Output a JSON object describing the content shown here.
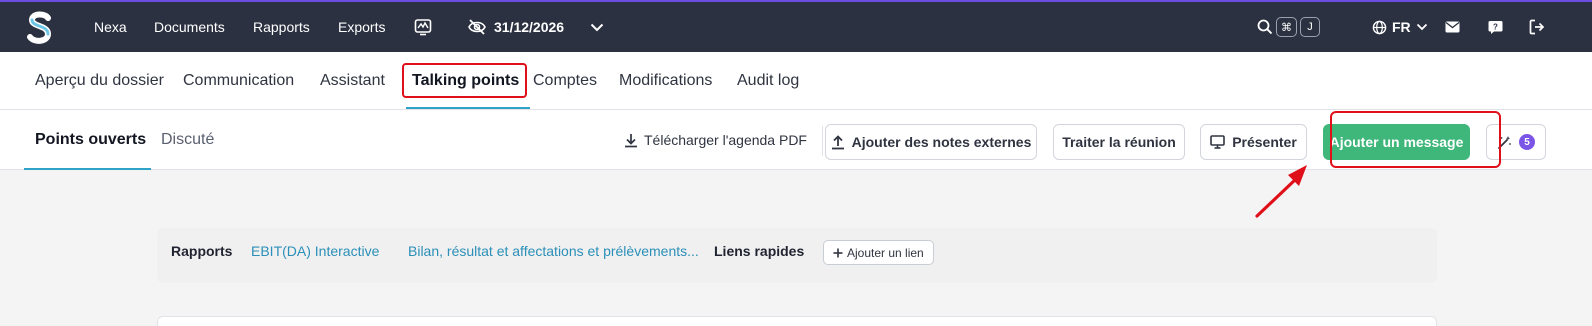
{
  "topbar": {
    "nav": [
      "Nexa",
      "Documents",
      "Rapports",
      "Exports"
    ],
    "date": "31/12/2026",
    "shortcut_keys": [
      "⌘",
      "J"
    ],
    "language": "FR",
    "accent_color": "#6d4ce0",
    "icons": [
      "logo",
      "monitor-chart-icon",
      "eye-slash-icon",
      "chevron-down-icon",
      "search-icon",
      "globe-icon",
      "mail-icon",
      "help-icon",
      "logout-icon"
    ]
  },
  "tabs": {
    "items": [
      "Aperçu du dossier",
      "Communication",
      "Assistant",
      "Talking points",
      "Comptes",
      "Modifications",
      "Audit log"
    ],
    "active": "Talking points"
  },
  "subbar": {
    "subtabs": [
      "Points ouverts",
      "Discuté"
    ],
    "active": "Points ouverts",
    "download_label": "Télécharger l'agenda PDF",
    "add_notes_label": "Ajouter des notes externes",
    "process_meeting_label": "Traiter la réunion",
    "present_label": "Présenter",
    "add_message_label": "Ajouter un message",
    "magic_badge": "5",
    "primary_color": "#3fb77a"
  },
  "links": {
    "reports_label": "Rapports",
    "report_links": [
      "EBIT(DA) Interactive",
      "Bilan, résultat et affectations et prélèvements..."
    ],
    "quick_links_label": "Liens rapides",
    "add_link_label": "Ajouter un lien"
  },
  "annotation_color": "#e0101a"
}
